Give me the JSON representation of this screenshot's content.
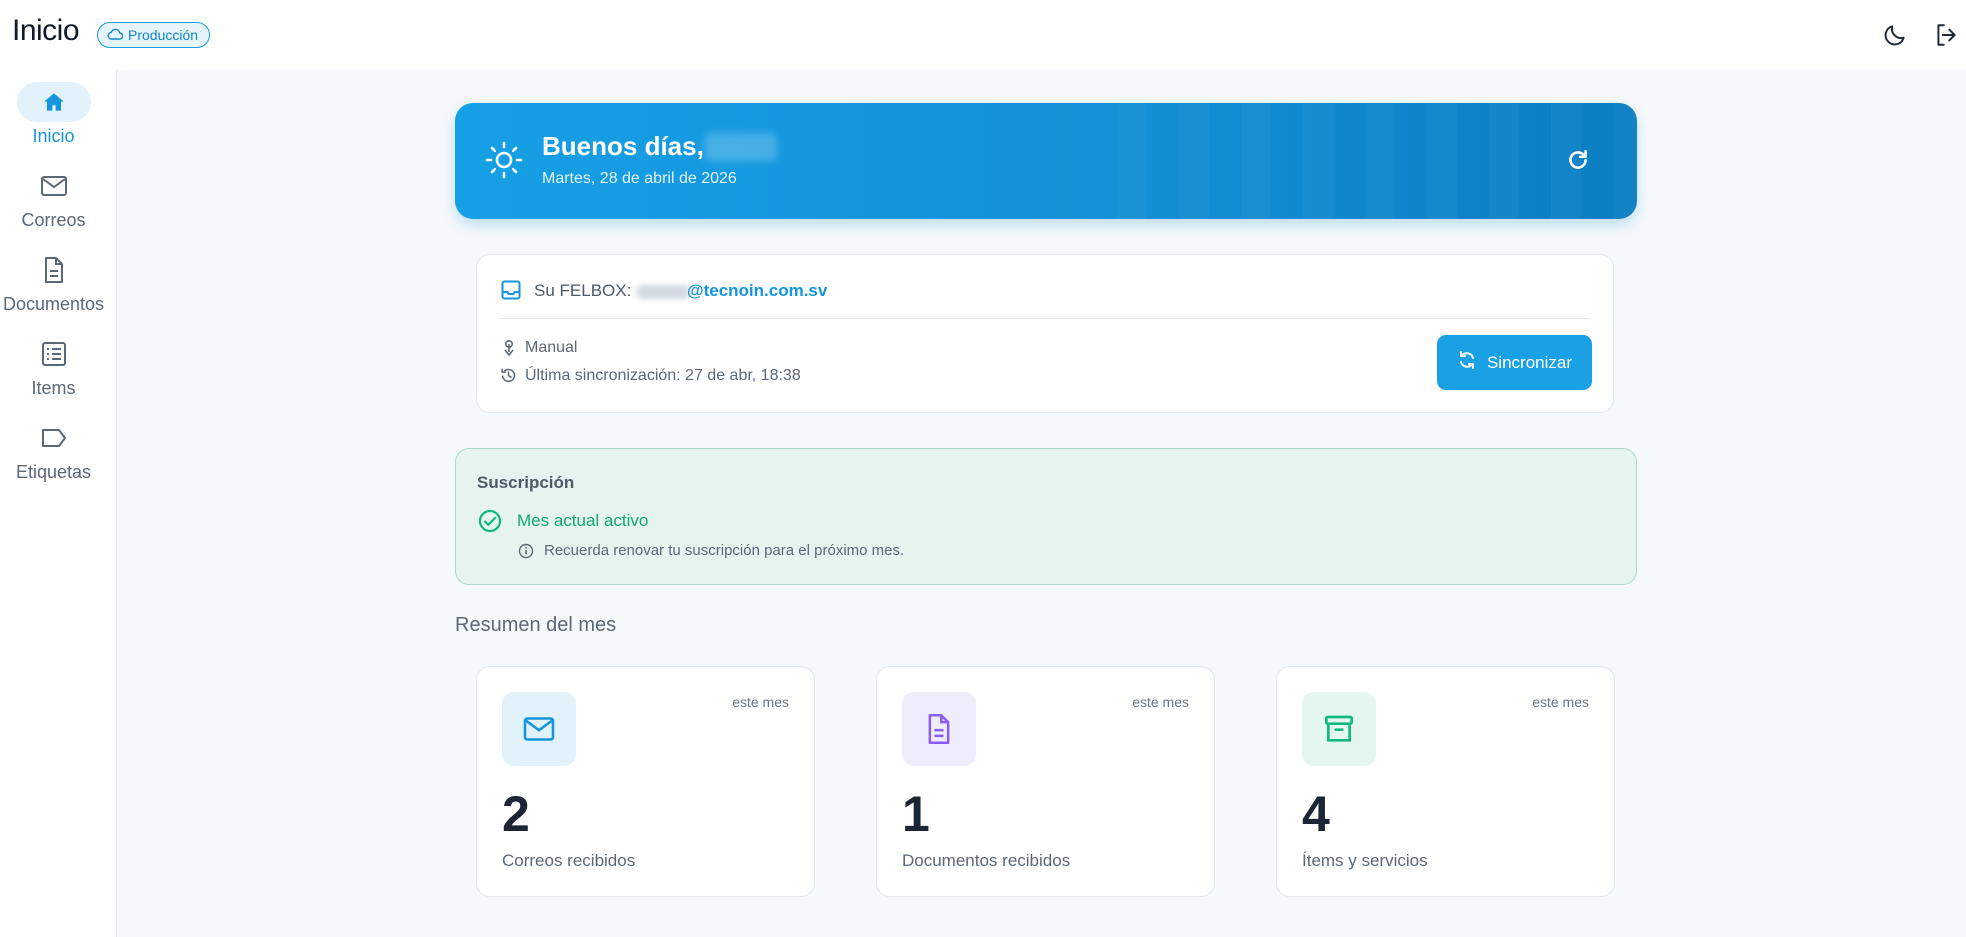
{
  "app": {
    "title": "Inicio",
    "environment_badge": "Producción"
  },
  "sidebar": {
    "items": [
      {
        "label": "Inicio",
        "icon": "home-icon",
        "active": true
      },
      {
        "label": "Correos",
        "icon": "mail-icon",
        "active": false
      },
      {
        "label": "Documentos",
        "icon": "document-icon",
        "active": false
      },
      {
        "label": "Items",
        "icon": "list-icon",
        "active": false
      },
      {
        "label": "Etiquetas",
        "icon": "tag-icon",
        "active": false
      }
    ]
  },
  "hero": {
    "greeting": "Buenos días,",
    "date": "Martes, 28 de abril de 2026"
  },
  "felbox": {
    "label": "Su FELBOX:",
    "email_domain": "@tecnoin.com.sv",
    "mode": "Manual",
    "last_sync": "Última sincronización: 27 de abr, 18:38",
    "sync_button": "Sincronizar"
  },
  "subscription": {
    "title": "Suscripción",
    "status": "Mes actual activo",
    "note": "Recuerda renovar tu suscripción para el próximo mes."
  },
  "summary": {
    "title": "Resumen del mes",
    "cards": [
      {
        "value": "2",
        "label": "Correos recibidos",
        "period": "este mes",
        "icon": "mail-icon",
        "color": "#1596dc",
        "bg": "#e2f2fb"
      },
      {
        "value": "1",
        "label": "Documentos recibidos",
        "period": "este mes",
        "icon": "document-icon",
        "color": "#8b5cf6",
        "bg": "#efedfb"
      },
      {
        "value": "4",
        "label": "Ítems y servicios",
        "period": "este mes",
        "icon": "archive-icon",
        "color": "#10b981",
        "bg": "#e3f6ef"
      }
    ]
  },
  "colors": {
    "accent": "#1596dc",
    "success": "#10b981",
    "hero_start": "#16a0e6",
    "hero_end": "#0b7dc3"
  }
}
